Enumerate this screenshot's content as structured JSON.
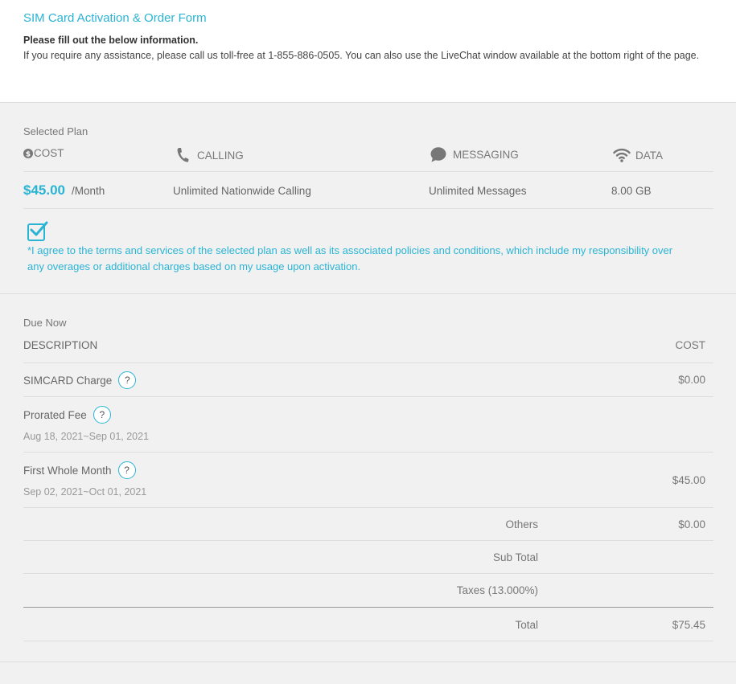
{
  "header": {
    "title": "SIM Card Activation & Order Form",
    "subtitle": "Please fill out the below information.",
    "note": "If you require any assistance, please call us toll-free at 1-855-886-0505. You can also use the LiveChat window available at the bottom right of the page."
  },
  "plan": {
    "label": "Selected Plan",
    "columns": {
      "cost": "COST",
      "calling": "CALLING",
      "messaging": "MESSAGING",
      "data": "DATA"
    },
    "price": "$45.00",
    "per_month": "/Month",
    "calling": "Unlimited Nationwide Calling",
    "messaging": "Unlimited Messages",
    "data": "8.00 GB",
    "agree_checked": true,
    "agree_text": "*I agree to the terms and services of the selected plan as well as its associated policies and conditions, which include my responsibility over any overages or additional charges based on my usage upon activation."
  },
  "due": {
    "label": "Due Now",
    "description_header": "DESCRIPTION",
    "cost_header": "COST",
    "simcard_label": "SIMCARD Charge",
    "simcard_cost": "$0.00",
    "prorated_label": "Prorated Fee",
    "prorated_dates": "Aug 18, 2021~Sep 01, 2021",
    "first_month_label": "First Whole Month",
    "first_month_dates": "Sep 02, 2021~Oct 01, 2021",
    "first_month_cost": "$45.00",
    "others_label": "Others",
    "others_cost": "$0.00",
    "subtotal_label": "Sub Total",
    "taxes_label": "Taxes (13.000%)",
    "total_label": "Total",
    "total_cost": "$75.45",
    "help_glyph": "?"
  },
  "colors": {
    "accent": "#2ab4d4",
    "background": "#f1f1f1"
  }
}
